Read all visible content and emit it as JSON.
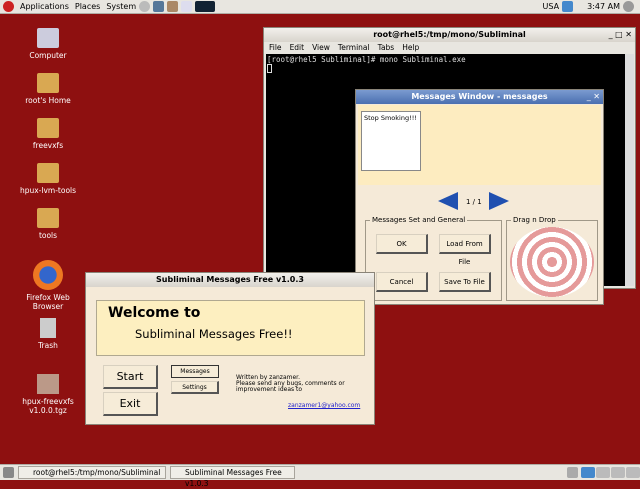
{
  "top_panel": {
    "menus": [
      "Applications",
      "Places",
      "System"
    ],
    "keyboard": "USA",
    "clock": "3:47 AM"
  },
  "desktop_icons": [
    {
      "label": "Computer"
    },
    {
      "label": "root's Home"
    },
    {
      "label": "freevxfs"
    },
    {
      "label": "hpux-lvm-tools"
    },
    {
      "label": "tools"
    },
    {
      "label": "Firefox Web Browser"
    },
    {
      "label": "Trash"
    },
    {
      "label": "hpux-freevxfs v1.0.0.tgz"
    }
  ],
  "terminal": {
    "title": "root@rhel5:/tmp/mono/Subliminal",
    "menus": [
      "File",
      "Edit",
      "View",
      "Terminal",
      "Tabs",
      "Help"
    ],
    "line": "[root@rhel5 Subliminal]# mono Subliminal.exe"
  },
  "messages_window": {
    "title": "Messages Window - messages",
    "message_text": "Stop Smoking!!!",
    "page": "1 / 1",
    "group1": "Messages Set and General",
    "ok": "OK",
    "load": "Load From File",
    "cancel": "Cancel",
    "save": "Save To File",
    "group2": "Drag n Drop"
  },
  "main_window": {
    "title": "Subliminal Messages Free v1.0.3",
    "welcome": "Welcome to",
    "app_name": "Subliminal Messages Free!!",
    "start": "Start",
    "exit": "Exit",
    "messages": "Messages",
    "settings": "Settings",
    "about": "Written by zanzamer.\nPlease send any bugs, comments or improvement ideas to",
    "email": "zanzamer1@yahoo.com"
  },
  "taskbar": {
    "items": [
      "root@rhel5:/tmp/mono/Subliminal",
      "Subliminal Messages Free v1.0.3"
    ]
  }
}
